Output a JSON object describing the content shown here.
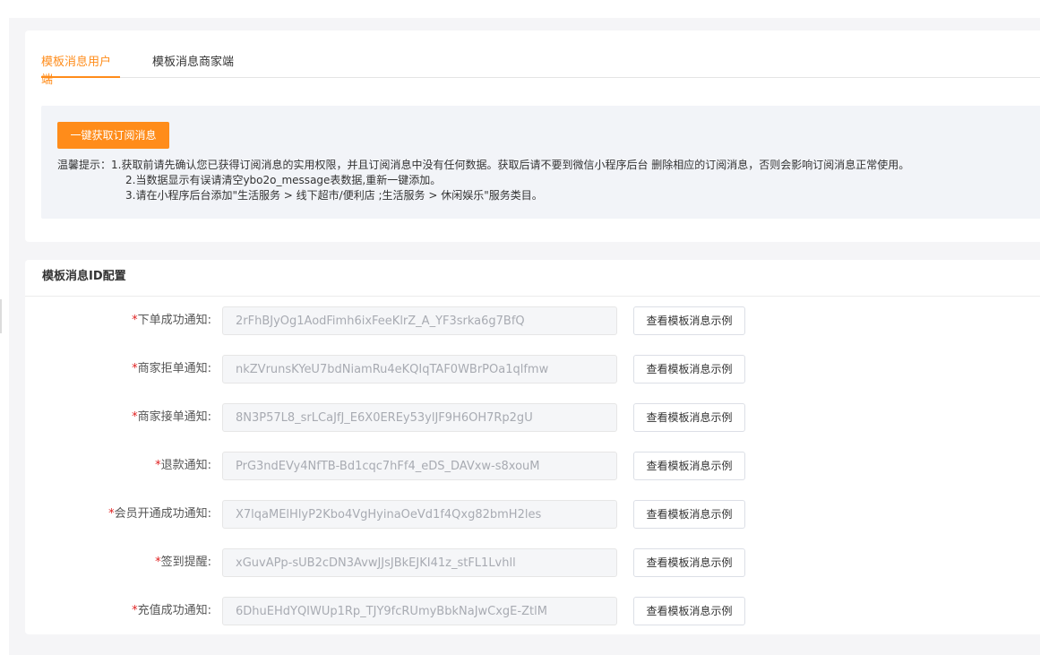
{
  "tabs": [
    {
      "label": "模板消息用户端",
      "active": true
    },
    {
      "label": "模板消息商家端",
      "active": false
    }
  ],
  "notice": {
    "fetch_button": "一键获取订阅消息",
    "tip_label": "温馨提示：",
    "lines": [
      "1.获取前请先确认您已获得订阅消息的实用权限，并且订阅消息中没有任何数据。获取后请不要到微信小程序后台 删除相应的订阅消息，否则会影响订阅消息正常使用。",
      "2.当数据显示有误请清空ybo2o_message表数据,重新一键添加。",
      "3.请在小程序后台添加\"生活服务 > 线下超市/便利店 ;生活服务 > 休闲娱乐\"服务类目。"
    ]
  },
  "config": {
    "title": "模板消息ID配置",
    "required_mark": "*",
    "example_button": "查看模板消息示例",
    "rows": [
      {
        "label": "下单成功通知:",
        "value": "2rFhBJyOg1AodFimh6ixFeeKlrZ_A_YF3srka6g7BfQ"
      },
      {
        "label": "商家拒单通知:",
        "value": "nkZVrunsKYeU7bdNiamRu4eKQIqTAF0WBrPOa1qlfmw"
      },
      {
        "label": "商家接单通知:",
        "value": "8N3P57L8_srLCaJfJ_E6X0EREy53ylJF9H6OH7Rp2gU"
      },
      {
        "label": "退款通知:",
        "value": "PrG3ndEVy4NfTB-Bd1cqc7hFf4_eDS_DAVxw-s8xouM"
      },
      {
        "label": "会员开通成功通知:",
        "value": "X7lqaMElHlyP2Kbo4VgHyinaOeVd1f4Qxg82bmH2les"
      },
      {
        "label": "签到提醒:",
        "value": "xGuvAPp-sUB2cDN3AvwJJsJBkEJKI41z_stFL1Lvhll"
      },
      {
        "label": "充值成功通知:",
        "value": "6DhuEHdYQIWUp1Rp_TJY9fcRUmyBbkNaJwCxgE-ZtlM"
      }
    ]
  }
}
